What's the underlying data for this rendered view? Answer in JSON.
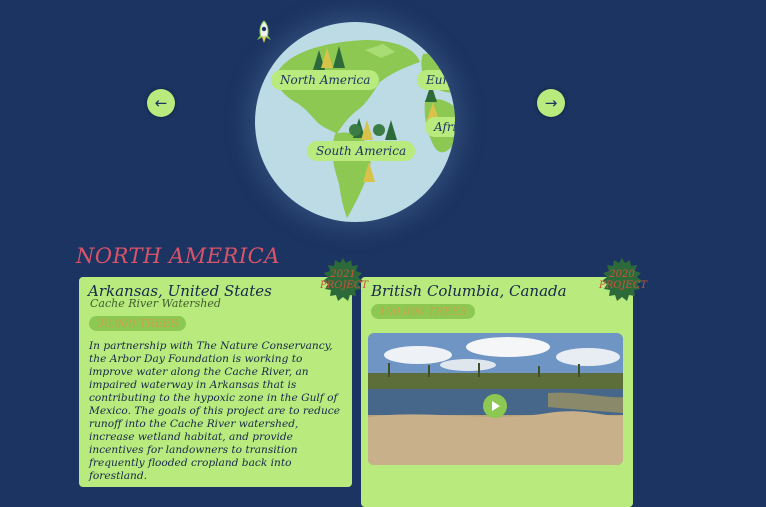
{
  "nav": {
    "prev_icon": "←",
    "next_icon": "→"
  },
  "globe": {
    "labels": {
      "north_america": "North America",
      "south_america": "South America",
      "europe": "Europe",
      "africa": "Africa"
    }
  },
  "section_title": "NORTH AMERICA",
  "projects": [
    {
      "year": "2021",
      "badge_word": "PROJECT",
      "title": "Arkansas, United States",
      "subtitle": "Cache River Watershed",
      "trees": "30,000 TREES",
      "description": "In partnership with The Nature Conservancy, the Arbor Day Foundation is working to improve water along the Cache River, an impaired waterway in Arkansas that is contributing to the hypoxic zone in the Gulf of Mexico. The goals of this project are to reduce runoff into the Cache River watershed, increase wetland habitat, and provide incentives for landowners to transition frequently flooded cropland back into forestland."
    },
    {
      "year": "2020",
      "badge_word": "PROJECT",
      "title": "British Columbia, Canada",
      "trees": "100,000 TREES"
    }
  ],
  "colors": {
    "background": "#1c3461",
    "accent_green": "#b8ea7e",
    "title_pink": "#d9546a",
    "badge_gold": "#c9a24d"
  }
}
